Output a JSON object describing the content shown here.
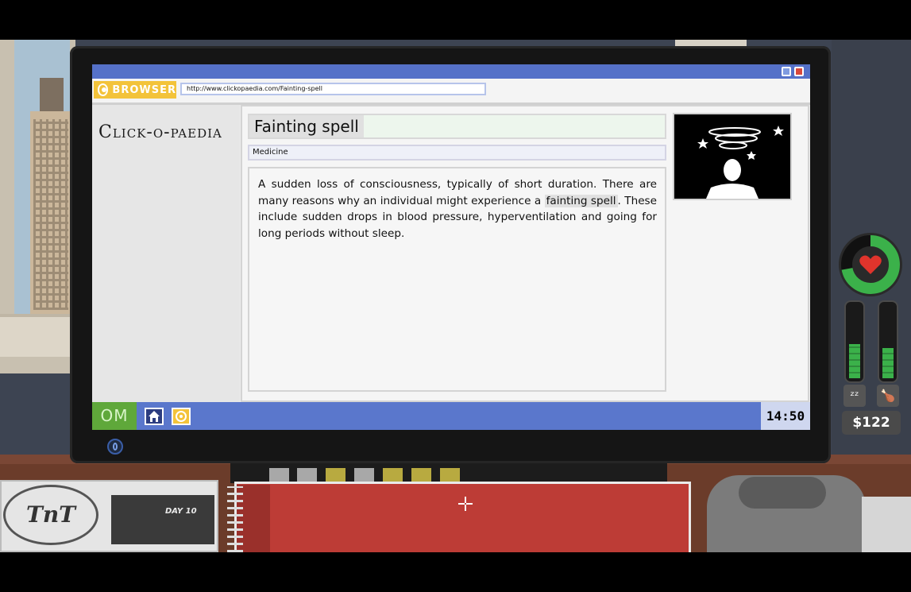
{
  "browser": {
    "app_label": "BROWSER",
    "url": "http://www.clickopaedia.com/Fainting-spell"
  },
  "site": {
    "logo_text": "Click-o-paedia"
  },
  "article": {
    "title": "Fainting spell",
    "category": "Medicine",
    "body_before": "A sudden loss of consciousness, typically of short duration. There are many reasons why an individual might experience a ",
    "body_link": "fainting spell",
    "body_after": ". These include sudden drops in blood pressure, hyperventilation and going for long periods without sleep."
  },
  "taskbar": {
    "start_label": "OM",
    "clock": "14:50"
  },
  "hud": {
    "money": "$122",
    "health_level": 0.72,
    "sleep_level": 0.45,
    "food_level": 0.4
  },
  "newspaper": {
    "masthead": "TnT",
    "day_label": "DAY 10"
  },
  "icons": {
    "sleep": "sleep-icon",
    "food": "food-icon",
    "heart": "heart-icon"
  },
  "colors": {
    "taskbar": "#5a77cc",
    "browser_badge": "#f3c33a",
    "health_green": "#3bb14a",
    "notebook_red": "#bd3c36"
  }
}
